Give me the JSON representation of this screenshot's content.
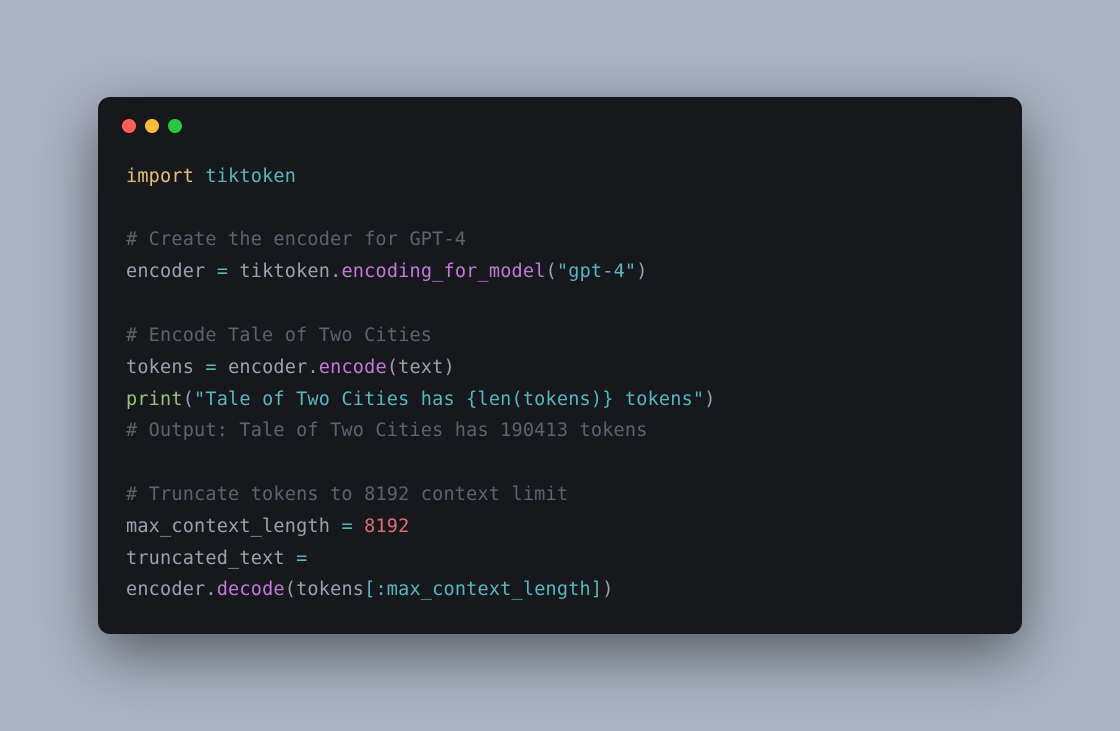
{
  "code": {
    "line1_import": "import",
    "line1_mod": "tiktoken",
    "line2_comment": "# Create the encoder for GPT-4",
    "line3_ident": "encoder",
    "line3_eq": "=",
    "line3_mod": "tiktoken",
    "line3_dot": ".",
    "line3_call": "encoding_for_model",
    "line3_open": "(",
    "line3_str": "\"gpt-4\"",
    "line3_close": ")",
    "line4_comment": "# Encode Tale of Two Cities",
    "line5_ident": "tokens",
    "line5_eq": "=",
    "line5_rhs_enc": "encoder",
    "line5_dot": ".",
    "line5_call": "encode",
    "line5_open": "(",
    "line5_arg": "text",
    "line5_close": ")",
    "line6_print": "print",
    "line6_open": "(",
    "line6_str": "\"Tale of Two Cities has {len(tokens)} tokens\"",
    "line6_close": ")",
    "line7_comment": "# Output: Tale of Two Cities has 190413 tokens",
    "line8_comment": "# Truncate tokens to 8192 context limit",
    "line9_ident": "max_context_length",
    "line9_eq": "=",
    "line9_num": "8192",
    "line10_ident": "truncated_text",
    "line10_eq": "=",
    "line11_enc": "encoder",
    "line11_dot": ".",
    "line11_call": "decode",
    "line11_open": "(",
    "line11_tok": "tokens",
    "line11_slice": "[:max_context_length]",
    "line11_close": ")"
  }
}
